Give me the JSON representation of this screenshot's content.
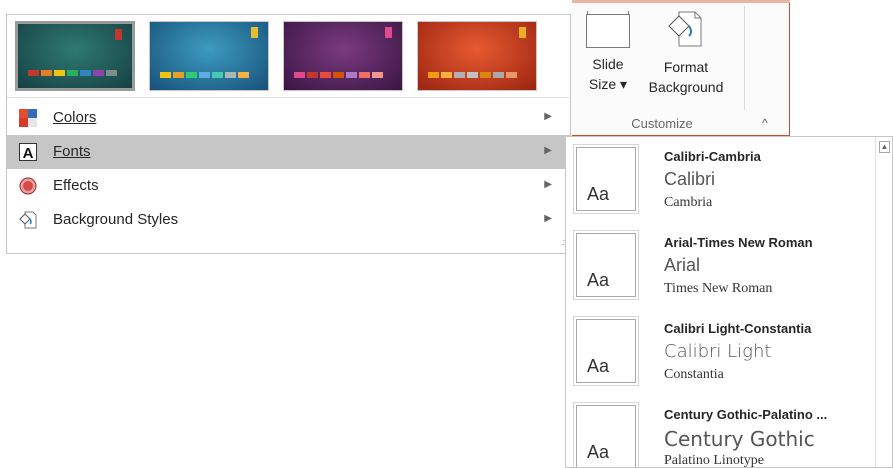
{
  "ribbon": {
    "slide_size_line1": "Slide",
    "slide_size_line2": "Size ▾",
    "format_bg_line1": "Format",
    "format_bg_line2": "Background",
    "group_label": "Customize",
    "collapse_glyph": "^"
  },
  "variants": {
    "thumbnails": [
      {
        "bg": "#1f5a5a",
        "flag": "#c0392b",
        "selected": true
      },
      {
        "bg": "#1d6f95",
        "flag": "#e4c030",
        "selected": false
      },
      {
        "bg": "#5a2260",
        "flag": "#e04a8a",
        "selected": false
      },
      {
        "bg": "#c43a1c",
        "flag": "#e8b020",
        "selected": false
      }
    ],
    "menu": [
      {
        "label": "Colors",
        "icon": "colors-icon"
      },
      {
        "label": "Fonts",
        "icon": "fonts-icon"
      },
      {
        "label": "Effects",
        "icon": "effects-icon"
      },
      {
        "label": "Background Styles",
        "icon": "background-styles-icon"
      }
    ],
    "submenu_arrow": "▶"
  },
  "fonts_gallery": {
    "sample": "Aa",
    "items": [
      {
        "name": "Calibri-Cambria",
        "heading": "Calibri",
        "body": "Cambria"
      },
      {
        "name": "Arial-Times New Roman",
        "heading": "Arial",
        "body": "Times New Roman"
      },
      {
        "name": "Calibri Light-Constantia",
        "heading": "Calibri Light",
        "body": "Constantia"
      },
      {
        "name": "Century Gothic-Palatino ...",
        "heading": "Century Gothic",
        "body": "Palatino Linotype"
      }
    ]
  }
}
